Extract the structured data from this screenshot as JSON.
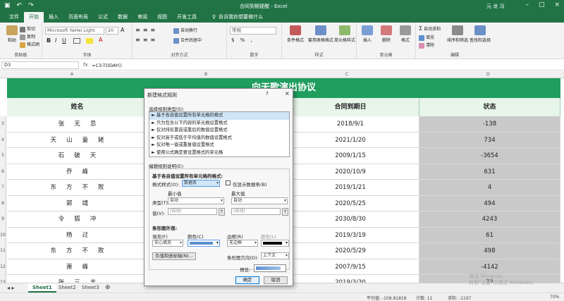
{
  "window": {
    "title": "合同到期提醒  -  Excel",
    "user": "元 龙 冯"
  },
  "tabs": [
    "文件",
    "开始",
    "插入",
    "页面布局",
    "公式",
    "数据",
    "审阅",
    "视图",
    "开发工具"
  ],
  "tell_me": "告诉我你想要做什么",
  "ribbon": {
    "clipboard": {
      "paste": "粘贴",
      "cut": "剪切",
      "copy": "复制",
      "painter": "格式刷",
      "label": "剪贴板"
    },
    "font": {
      "name": "Microsoft YaHei Light",
      "size": "20",
      "label": "字体"
    },
    "align": {
      "wrap": "自动换行",
      "merge": "合并后居中",
      "label": "对齐方式"
    },
    "number": {
      "format": "常规",
      "label": "数字"
    },
    "styles": {
      "cond": "条件格式",
      "table": "套用表格格式",
      "cell": "单元格样式",
      "label": "样式"
    },
    "cells": {
      "insert": "插入",
      "delete": "删除",
      "format": "格式",
      "label": "单元格"
    },
    "editing": {
      "autosum": "自动求和",
      "fill": "填充",
      "clear": "清除",
      "sort": "排序和筛选",
      "find": "查找和选择",
      "label": "编辑"
    }
  },
  "formula_bar": {
    "name_box": "D3",
    "formula": "=C3-TODAY()"
  },
  "columns": [
    "A",
    "B",
    "C",
    "D"
  ],
  "sheet": {
    "title": "向天歌演出协议",
    "headers": [
      "姓名",
      "",
      "合同到期日",
      "状态"
    ],
    "rows": [
      {
        "num": "3",
        "name": "张无忌",
        "date": "2018/9/1",
        "status": "-138"
      },
      {
        "num": "4",
        "name": "天山童姥",
        "date": "2021/1/20",
        "status": "734"
      },
      {
        "num": "5",
        "name": "石破天",
        "date": "2009/1/15",
        "status": "-3654"
      },
      {
        "num": "6",
        "name": "乔峰",
        "date": "2020/10/9",
        "status": "631"
      },
      {
        "num": "7",
        "name": "东方不败",
        "date": "2019/1/21",
        "status": "4"
      },
      {
        "num": "8",
        "name": "郭靖",
        "date": "2020/5/25",
        "status": "494"
      },
      {
        "num": "9",
        "name": "令狐冲",
        "date": "2030/8/30",
        "status": "4243"
      },
      {
        "num": "10",
        "name": "杨过",
        "date": "2019/3/19",
        "status": "61"
      },
      {
        "num": "11",
        "name": "东方不败",
        "date": "2020/5/29",
        "status": "498"
      },
      {
        "num": "12",
        "name": "萧峰",
        "date": "2007/9/15",
        "status": "-4142"
      },
      {
        "num": "13",
        "name": "张三丰",
        "date": "2019/3/30",
        "status": "72"
      }
    ]
  },
  "sheet_tabs": [
    "Sheet1",
    "Sheet2",
    "Sheet3"
  ],
  "status_bar": {
    "average": "平均值: -108.81818",
    "count": "计数: 11",
    "sum": "求和: -1197",
    "zoom": "70%"
  },
  "watermark": {
    "line1": "激活 Windows",
    "line2": "转到\"设置\"以激活 Windows。"
  },
  "dialog": {
    "title": "新建格式规则",
    "help": "?",
    "close": "×",
    "rule_type_label": "选择规则类型(S):",
    "rule_types": [
      "► 基于各自值设置所有单元格的格式",
      "► 只为包含以下内容的单元格设置格式",
      "► 仅对排名靠前或靠后的数值设置格式",
      "► 仅对高于或低于平均值的数值设置格式",
      "► 仅对唯一值或重复值设置格式",
      "► 使用公式确定要设置格式的单元格"
    ],
    "edit_label": "编辑规则说明(E):",
    "desc_title": "基于各自值设置所有单元格的格式:",
    "style_label": "格式样式(O):",
    "style_value": "数据条",
    "show_bar_only": "仅显示数据条(B)",
    "min_label": "最小值",
    "max_label": "最大值",
    "type_label": "类型(T):",
    "type_min": "自动",
    "type_max": "自动",
    "value_label": "值(V):",
    "value_min": "(自动)",
    "value_max": "(自动)",
    "bar_appearance": "条形图外观:",
    "fill_label": "填充(F)",
    "fill_value": "实心填充",
    "color_label": "颜色(C)",
    "border_label": "边框(R)",
    "border_value": "无边框",
    "border_color_label": "颜色(L)",
    "neg_axis_btn": "负值和坐标轴(N)...",
    "direction_label": "条形图方向(D):",
    "direction_value": "上下文",
    "preview_label": "预览:",
    "ok": "确定",
    "cancel": "取消"
  },
  "colors": {
    "excel_green": "#217346",
    "title_fill": "#1f9e5e",
    "header_fill": "#e8f5e9",
    "status_fill": "#c9c9c9",
    "bar_color": "#5b8fd0"
  }
}
